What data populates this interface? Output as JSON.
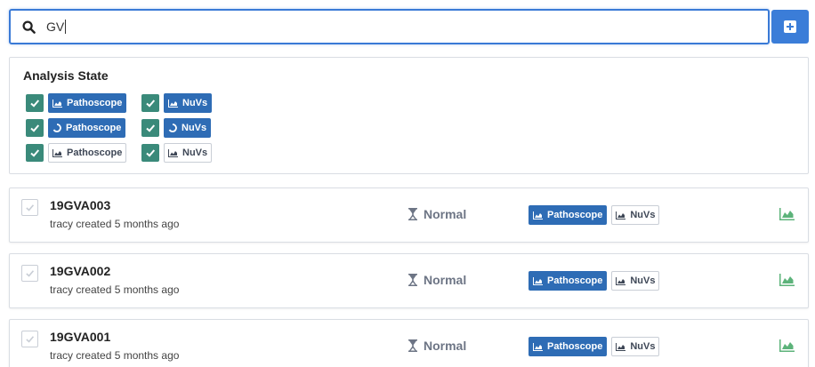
{
  "search": {
    "value": "GV",
    "placeholder": ""
  },
  "add_button": {
    "icon": "plus-square-icon"
  },
  "filter": {
    "title": "Analysis State",
    "rows": [
      {
        "pathoscope": {
          "label": "Pathoscope",
          "state": "ready",
          "checked": true
        },
        "nuvs": {
          "label": "NuVs",
          "state": "ready",
          "checked": true
        }
      },
      {
        "pathoscope": {
          "label": "Pathoscope",
          "state": "running",
          "checked": true
        },
        "nuvs": {
          "label": "NuVs",
          "state": "running",
          "checked": true
        }
      },
      {
        "pathoscope": {
          "label": "Pathoscope",
          "state": "none",
          "checked": true
        },
        "nuvs": {
          "label": "NuVs",
          "state": "none",
          "checked": true
        }
      }
    ]
  },
  "samples": [
    {
      "name": "19GVA003",
      "meta": "tracy created 5 months ago",
      "status": "Normal",
      "tags": [
        "Pathoscope",
        "NuVs"
      ]
    },
    {
      "name": "19GVA002",
      "meta": "tracy created 5 months ago",
      "status": "Normal",
      "tags": [
        "Pathoscope",
        "NuVs"
      ]
    },
    {
      "name": "19GVA001",
      "meta": "tracy created 5 months ago",
      "status": "Normal",
      "tags": [
        "Pathoscope",
        "NuVs"
      ]
    }
  ],
  "colors": {
    "accent": "#3b7dd8",
    "tag_solid": "#2e6cb5",
    "check_green": "#3a8a7a",
    "chart_green": "#5cb37a",
    "status_gray": "#6d7585"
  }
}
